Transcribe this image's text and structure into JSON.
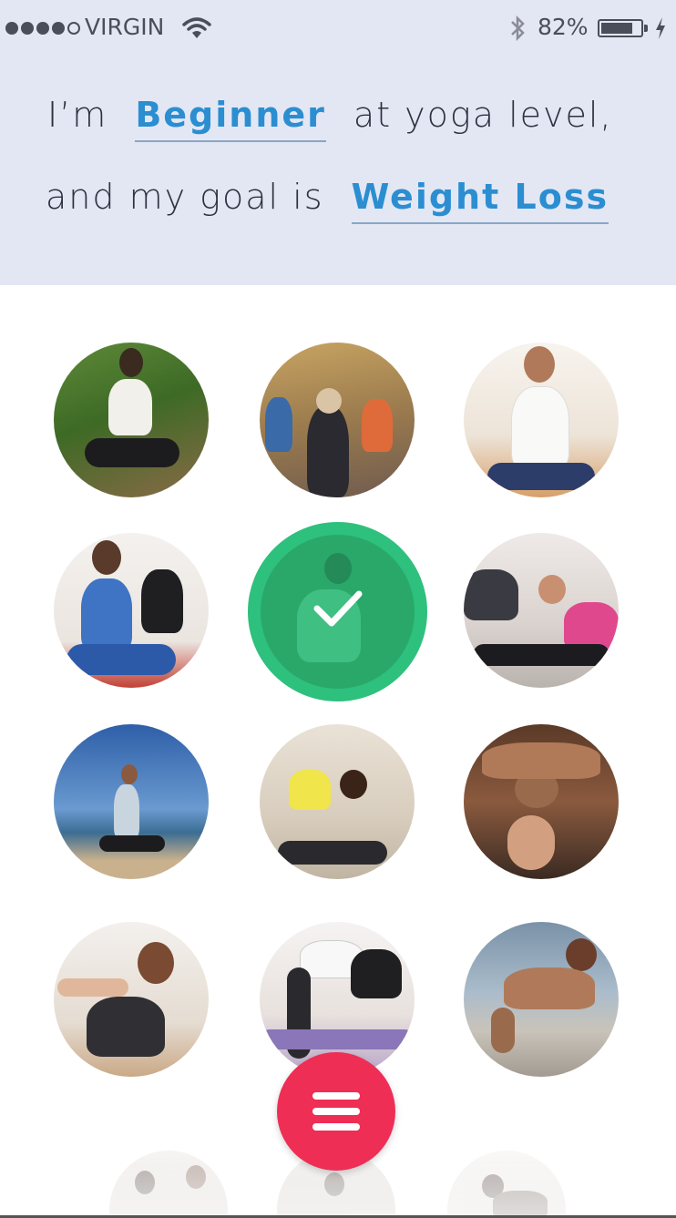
{
  "status_bar": {
    "carrier": "VIRGIN",
    "battery": "82%",
    "battery_level": 0.82,
    "signal_bars_filled": 4,
    "signal_bars_total": 5
  },
  "prompt": {
    "line1_before": "I’m",
    "level": "Beginner",
    "line1_after": "at yoga level,",
    "line2_before": "and my goal is",
    "goal": "Weight Loss"
  },
  "selection": {
    "selected_index": 4
  },
  "colors": {
    "header_bg": "#e3e7f4",
    "accent_blue": "#2b8ed1",
    "selected_green": "#2ec07d",
    "fab_red": "#ee2e55"
  },
  "icons": {
    "menu": "hamburger-menu-icon",
    "check": "checkmark-icon",
    "wifi": "wifi-icon",
    "bluetooth": "bluetooth-icon",
    "charging": "charging-bolt-icon"
  }
}
